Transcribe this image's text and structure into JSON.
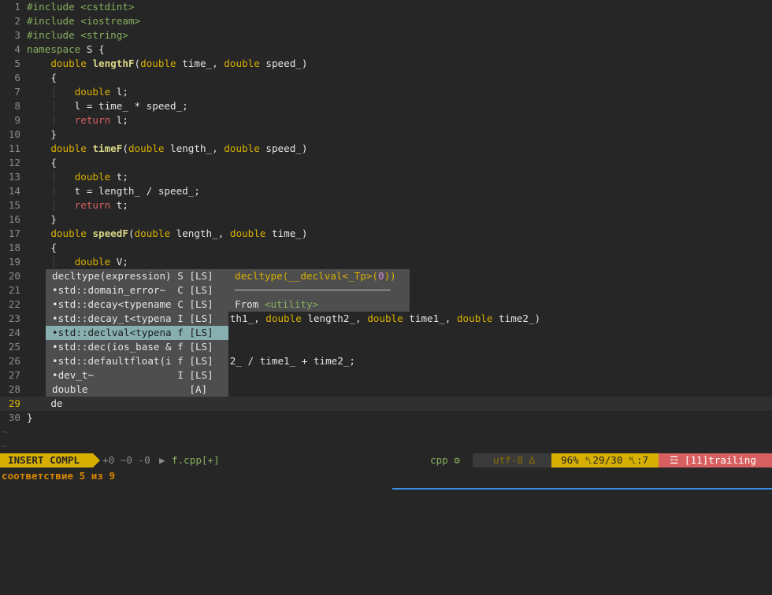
{
  "editor": {
    "lines": [
      {
        "num": "1",
        "tokens": [
          {
            "t": "pp",
            "v": "#include <cstdint>"
          }
        ]
      },
      {
        "num": "2",
        "tokens": [
          {
            "t": "pp",
            "v": "#include <iostream>"
          }
        ]
      },
      {
        "num": "3",
        "tokens": [
          {
            "t": "pp",
            "v": "#include <string>"
          }
        ]
      },
      {
        "num": "4",
        "tokens": [
          {
            "t": "kw",
            "v": "namespace"
          },
          {
            "t": "plain",
            "v": " S {"
          }
        ]
      },
      {
        "num": "5",
        "tokens": [
          {
            "t": "plain",
            "v": "    "
          },
          {
            "t": "ty",
            "v": "double"
          },
          {
            "t": "plain",
            "v": " "
          },
          {
            "t": "fn",
            "v": "lengthF"
          },
          {
            "t": "plain",
            "v": "("
          },
          {
            "t": "ty",
            "v": "double"
          },
          {
            "t": "plain",
            "v": " time_, "
          },
          {
            "t": "ty",
            "v": "double"
          },
          {
            "t": "plain",
            "v": " speed_)"
          }
        ]
      },
      {
        "num": "6",
        "tokens": [
          {
            "t": "plain",
            "v": "    {"
          }
        ]
      },
      {
        "num": "7",
        "tokens": [
          {
            "t": "plain",
            "v": "    "
          },
          {
            "t": "guide",
            "v": "┆"
          },
          {
            "t": "plain",
            "v": "   "
          },
          {
            "t": "ty",
            "v": "double"
          },
          {
            "t": "plain",
            "v": " l;"
          }
        ]
      },
      {
        "num": "8",
        "tokens": [
          {
            "t": "plain",
            "v": "    "
          },
          {
            "t": "guide",
            "v": "┆"
          },
          {
            "t": "plain",
            "v": "   l = time_ * speed_;"
          }
        ]
      },
      {
        "num": "9",
        "tokens": [
          {
            "t": "plain",
            "v": "    "
          },
          {
            "t": "guide",
            "v": "┆"
          },
          {
            "t": "plain",
            "v": "   "
          },
          {
            "t": "ret",
            "v": "return"
          },
          {
            "t": "plain",
            "v": " l;"
          }
        ]
      },
      {
        "num": "10",
        "tokens": [
          {
            "t": "plain",
            "v": "    }"
          }
        ]
      },
      {
        "num": "11",
        "tokens": [
          {
            "t": "plain",
            "v": "    "
          },
          {
            "t": "ty",
            "v": "double"
          },
          {
            "t": "plain",
            "v": " "
          },
          {
            "t": "fn",
            "v": "timeF"
          },
          {
            "t": "plain",
            "v": "("
          },
          {
            "t": "ty",
            "v": "double"
          },
          {
            "t": "plain",
            "v": " length_, "
          },
          {
            "t": "ty",
            "v": "double"
          },
          {
            "t": "plain",
            "v": " speed_)"
          }
        ]
      },
      {
        "num": "12",
        "tokens": [
          {
            "t": "plain",
            "v": "    {"
          }
        ]
      },
      {
        "num": "13",
        "tokens": [
          {
            "t": "plain",
            "v": "    "
          },
          {
            "t": "guide",
            "v": "┆"
          },
          {
            "t": "plain",
            "v": "   "
          },
          {
            "t": "ty",
            "v": "double"
          },
          {
            "t": "plain",
            "v": " t;"
          }
        ]
      },
      {
        "num": "14",
        "tokens": [
          {
            "t": "plain",
            "v": "    "
          },
          {
            "t": "guide",
            "v": "┆"
          },
          {
            "t": "plain",
            "v": "   t = length_ / speed_;"
          }
        ]
      },
      {
        "num": "15",
        "tokens": [
          {
            "t": "plain",
            "v": "    "
          },
          {
            "t": "guide",
            "v": "┆"
          },
          {
            "t": "plain",
            "v": "   "
          },
          {
            "t": "ret",
            "v": "return"
          },
          {
            "t": "plain",
            "v": " t;"
          }
        ]
      },
      {
        "num": "16",
        "tokens": [
          {
            "t": "plain",
            "v": "    }"
          }
        ]
      },
      {
        "num": "17",
        "tokens": [
          {
            "t": "plain",
            "v": "    "
          },
          {
            "t": "ty",
            "v": "double"
          },
          {
            "t": "plain",
            "v": " "
          },
          {
            "t": "fn",
            "v": "speedF"
          },
          {
            "t": "plain",
            "v": "("
          },
          {
            "t": "ty",
            "v": "double"
          },
          {
            "t": "plain",
            "v": " length_, "
          },
          {
            "t": "ty",
            "v": "double"
          },
          {
            "t": "plain",
            "v": " time_)"
          }
        ]
      },
      {
        "num": "18",
        "tokens": [
          {
            "t": "plain",
            "v": "    {"
          }
        ]
      },
      {
        "num": "19",
        "tokens": [
          {
            "t": "plain",
            "v": "    "
          },
          {
            "t": "guide",
            "v": "┆"
          },
          {
            "t": "plain",
            "v": "   "
          },
          {
            "t": "ty",
            "v": "double"
          },
          {
            "t": "plain",
            "v": " V;"
          }
        ]
      },
      {
        "num": "20",
        "tokens": [
          {
            "t": "plain",
            "v": ""
          }
        ]
      },
      {
        "num": "21",
        "tokens": [
          {
            "t": "plain",
            "v": ""
          }
        ]
      },
      {
        "num": "22",
        "tokens": [
          {
            "t": "plain",
            "v": ""
          }
        ]
      },
      {
        "num": "23",
        "tokens": [
          {
            "t": "plain",
            "v": "                                  th1_, "
          },
          {
            "t": "ty",
            "v": "double"
          },
          {
            "t": "plain",
            "v": " length2_, "
          },
          {
            "t": "ty",
            "v": "double"
          },
          {
            "t": "plain",
            "v": " time1_, "
          },
          {
            "t": "ty",
            "v": "double"
          },
          {
            "t": "plain",
            "v": " time2_)"
          }
        ]
      },
      {
        "num": "24",
        "tokens": [
          {
            "t": "plain",
            "v": ""
          }
        ]
      },
      {
        "num": "25",
        "tokens": [
          {
            "t": "plain",
            "v": ""
          }
        ]
      },
      {
        "num": "26",
        "tokens": [
          {
            "t": "plain",
            "v": "                                  2_ / time1_ + time2_;"
          }
        ]
      },
      {
        "num": "27",
        "tokens": [
          {
            "t": "plain",
            "v": ""
          }
        ]
      },
      {
        "num": "28",
        "tokens": [
          {
            "t": "plain",
            "v": ""
          }
        ]
      },
      {
        "num": "29",
        "tokens": [
          {
            "t": "plain",
            "v": "    de"
          }
        ],
        "current": true
      },
      {
        "num": "30",
        "tokens": [
          {
            "t": "plain",
            "v": "}"
          }
        ]
      }
    ],
    "tildes": [
      "~",
      "~"
    ]
  },
  "popup": {
    "items": [
      {
        "label": "decltype(expression) S [LS]",
        "selected": false
      },
      {
        "label": "•std::domain_error~  C [LS]",
        "selected": false
      },
      {
        "label": "•std::decay<typename C [LS]",
        "selected": false
      },
      {
        "label": "•std::decay_t<typena I [LS]",
        "selected": false
      },
      {
        "label": "•std::declval<typena f [LS]",
        "selected": true
      },
      {
        "label": "•std::dec(ios_base & f [LS]",
        "selected": false
      },
      {
        "label": "•std::defaultfloat(i f [LS]",
        "selected": false
      },
      {
        "label": "•dev_t~              I [LS]",
        "selected": false
      },
      {
        "label": "double                 [A]",
        "selected": false
      }
    ],
    "preview": {
      "sig_prefix": "decltype(__declval<_Tp>(",
      "sig_num": "0",
      "sig_suffix": "))",
      "rule": "──────────────────────────",
      "from_label": "From ",
      "from_module": "<utility>"
    }
  },
  "statusline": {
    "mode": "INSERT COMPL",
    "hunks": "+0 ~0 -0",
    "sep": "▶",
    "filename": "f.cpp[+]",
    "filetype": "cpp ⚙",
    "encoding": "utf-8 ∆",
    "position": "96% ␤29/30 ␤:7",
    "warning": "☲ [11]trailing"
  },
  "message": "соответствие 5 из 9",
  "colors": {
    "background": "#262626",
    "accent": "#d7af00",
    "selection": "#87afaf",
    "error": "#d75f5f"
  }
}
